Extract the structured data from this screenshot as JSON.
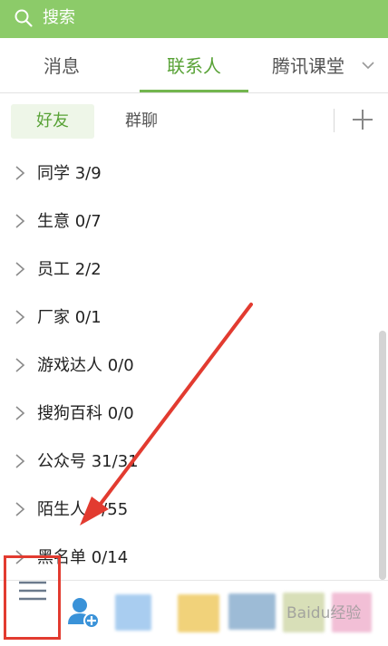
{
  "search": {
    "placeholder": "搜索"
  },
  "tabs": [
    {
      "label": "消息"
    },
    {
      "label": "联系人"
    },
    {
      "label": "腾讯课堂"
    }
  ],
  "subtabs": [
    {
      "label": "好友"
    },
    {
      "label": "群聊"
    }
  ],
  "groups": [
    {
      "label": "同学 3/9"
    },
    {
      "label": "生意 0/7"
    },
    {
      "label": "员工 2/2"
    },
    {
      "label": "厂家 0/1"
    },
    {
      "label": "游戏达人 0/0"
    },
    {
      "label": "搜狗百科 0/0"
    },
    {
      "label": "公众号 31/31"
    },
    {
      "label": "陌生人 4/55"
    },
    {
      "label": "黑名单 0/14"
    }
  ],
  "icons": {
    "search": "search-icon",
    "dropdown": "chevron-down-icon",
    "add": "plus-icon",
    "expand": "chevron-right-icon",
    "menu": "menu-icon",
    "contacts": "add-contact-icon"
  },
  "watermark": "Baidu经验",
  "colors": {
    "accent": "#8ccb69",
    "active_text": "#58a236",
    "annotation": "#e23b30"
  }
}
